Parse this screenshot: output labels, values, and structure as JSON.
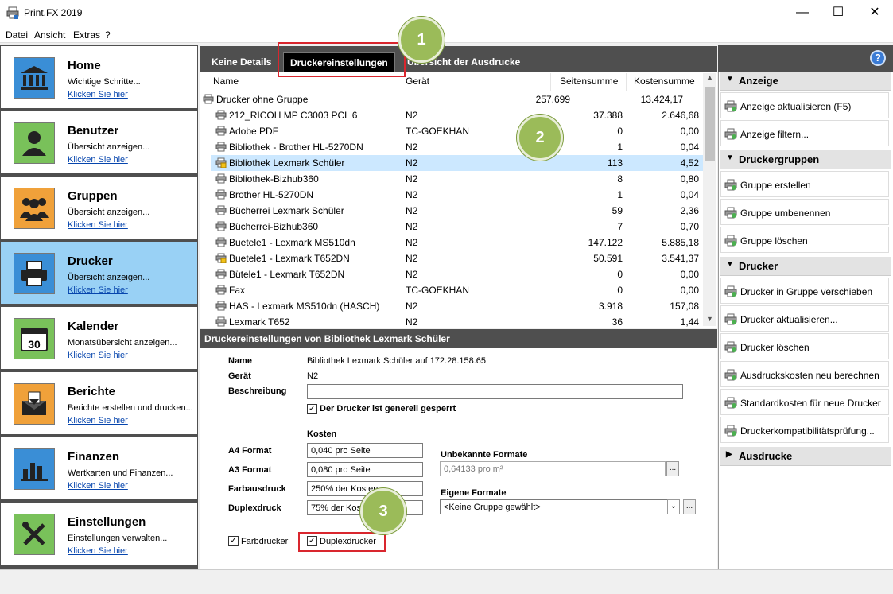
{
  "window": {
    "title": "Print.FX 2019"
  },
  "menu": [
    "Datei",
    "Ansicht",
    "Extras",
    "?"
  ],
  "nav": [
    {
      "title": "Home",
      "desc": "Wichtige Schritte...",
      "link": "Klicken Sie hier",
      "icon": "bank-icon",
      "color": "#3a8ed6"
    },
    {
      "title": "Benutzer",
      "desc": "Übersicht anzeigen...",
      "link": "Klicken Sie hier",
      "icon": "user-icon",
      "color": "#79c15a"
    },
    {
      "title": "Gruppen",
      "desc": "Übersicht anzeigen...",
      "link": "Klicken Sie hier",
      "icon": "group-icon",
      "color": "#f0a13a"
    },
    {
      "title": "Drucker",
      "desc": "Übersicht anzeigen...",
      "link": "Klicken Sie hier",
      "icon": "printer-icon",
      "color": "#3a8ed6"
    },
    {
      "title": "Kalender",
      "desc": "Monatsübersicht anzeigen...",
      "link": "Klicken Sie hier",
      "icon": "calendar-icon",
      "color": "#79c15a"
    },
    {
      "title": "Berichte",
      "desc": "Berichte erstellen und drucken...",
      "link": "Klicken Sie hier",
      "icon": "report-icon",
      "color": "#f0a13a"
    },
    {
      "title": "Finanzen",
      "desc": "Wertkarten und Finanzen...",
      "link": "Klicken Sie hier",
      "icon": "finance-chart-icon",
      "color": "#3a8ed6"
    },
    {
      "title": "Einstellungen",
      "desc": "Einstellungen verwalten...",
      "link": "Klicken Sie hier",
      "icon": "tools-icon",
      "color": "#79c15a"
    }
  ],
  "tabs": [
    "Keine Details",
    "Druckereinstellungen",
    "Übersicht der Ausdrucke"
  ],
  "list": {
    "columns": [
      "Name",
      "Gerät",
      "Seitensumme",
      "Kostensumme"
    ],
    "group": {
      "name": "Drucker ohne Gruppe",
      "pages": "257.699",
      "cost": "13.424,17"
    },
    "rows": [
      {
        "name": "212_RICOH MP C3003 PCL 6",
        "device": "N2",
        "pages": "37.388",
        "cost": "2.646,68",
        "locked": false
      },
      {
        "name": "Adobe PDF",
        "device": "TC-GOEKHAN",
        "pages": "0",
        "cost": "0,00",
        "locked": false
      },
      {
        "name": "Bibliothek - Brother HL-5270DN",
        "device": "N2",
        "pages": "1",
        "cost": "0,04",
        "locked": false
      },
      {
        "name": "Bibliothek Lexmark Schüler",
        "device": "N2",
        "pages": "113",
        "cost": "4,52",
        "locked": true,
        "selected": true
      },
      {
        "name": "Bibliothek-Bizhub360",
        "device": "N2",
        "pages": "8",
        "cost": "0,80",
        "locked": false
      },
      {
        "name": "Brother HL-5270DN",
        "device": "N2",
        "pages": "1",
        "cost": "0,04",
        "locked": false
      },
      {
        "name": "Bücherrei Lexmark Schüler",
        "device": "N2",
        "pages": "59",
        "cost": "2,36",
        "locked": false
      },
      {
        "name": "Bücherrei-Bizhub360",
        "device": "N2",
        "pages": "7",
        "cost": "0,70",
        "locked": false
      },
      {
        "name": "Buetele1 - Lexmark MS510dn",
        "device": "N2",
        "pages": "147.122",
        "cost": "5.885,18",
        "locked": false
      },
      {
        "name": "Buetele1 - Lexmark T652DN",
        "device": "N2",
        "pages": "50.591",
        "cost": "3.541,37",
        "locked": true
      },
      {
        "name": "Bütele1 - Lexmark T652DN",
        "device": "N2",
        "pages": "0",
        "cost": "0,00",
        "locked": false
      },
      {
        "name": "Fax",
        "device": "TC-GOEKHAN",
        "pages": "0",
        "cost": "0,00",
        "locked": false
      },
      {
        "name": "HAS - Lexmark MS510dn (HASCH)",
        "device": "N2",
        "pages": "3.918",
        "cost": "157,08",
        "locked": false
      },
      {
        "name": "Lexmark T652",
        "device": "N2",
        "pages": "36",
        "cost": "1,44",
        "locked": false
      }
    ]
  },
  "details": {
    "header": "Druckereinstellungen von Bibliothek Lexmark Schüler",
    "name_label": "Name",
    "name_value": "Bibliothek Lexmark Schüler auf 172.28.158.65",
    "device_label": "Gerät",
    "device_value": "N2",
    "desc_label": "Beschreibung",
    "desc_value": "",
    "locked_label": "Der Drucker ist generell gesperrt",
    "costs_label": "Kosten",
    "a4_label": "A4 Format",
    "a4_value": "0,040 pro Seite",
    "a3_label": "A3 Format",
    "a3_value": "0,080 pro Seite",
    "color_label": "Farbausdruck",
    "color_value": "250% der Kosten",
    "duplex_label": "Duplexdruck",
    "duplex_value": "75% der Kosten",
    "unknown_label": "Unbekannte Formate",
    "unknown_value": "0,64133 pro m²",
    "own_label": "Eigene Formate",
    "own_value": "<Keine Gruppe gewählt>",
    "color_printer_label": "Farbdrucker",
    "duplex_printer_label": "Duplexdrucker",
    "ellipsis": "..."
  },
  "right": {
    "sections": [
      {
        "title": "Anzeige",
        "items": [
          "Anzeige aktualisieren (F5)",
          "Anzeige filtern..."
        ]
      },
      {
        "title": "Druckergruppen",
        "items": [
          "Gruppe erstellen",
          "Gruppe umbenennen",
          "Gruppe löschen"
        ]
      },
      {
        "title": "Drucker",
        "items": [
          "Drucker in Gruppe verschieben",
          "Drucker aktualisieren...",
          "Drucker löschen",
          "Ausdruckskosten neu berechnen",
          "Standardkosten für neue Drucker",
          "Druckerkompatibilitätsprüfung..."
        ]
      },
      {
        "title": "Ausdrucke",
        "items": []
      }
    ],
    "help": "?"
  },
  "annotations": [
    "1",
    "2",
    "3"
  ]
}
